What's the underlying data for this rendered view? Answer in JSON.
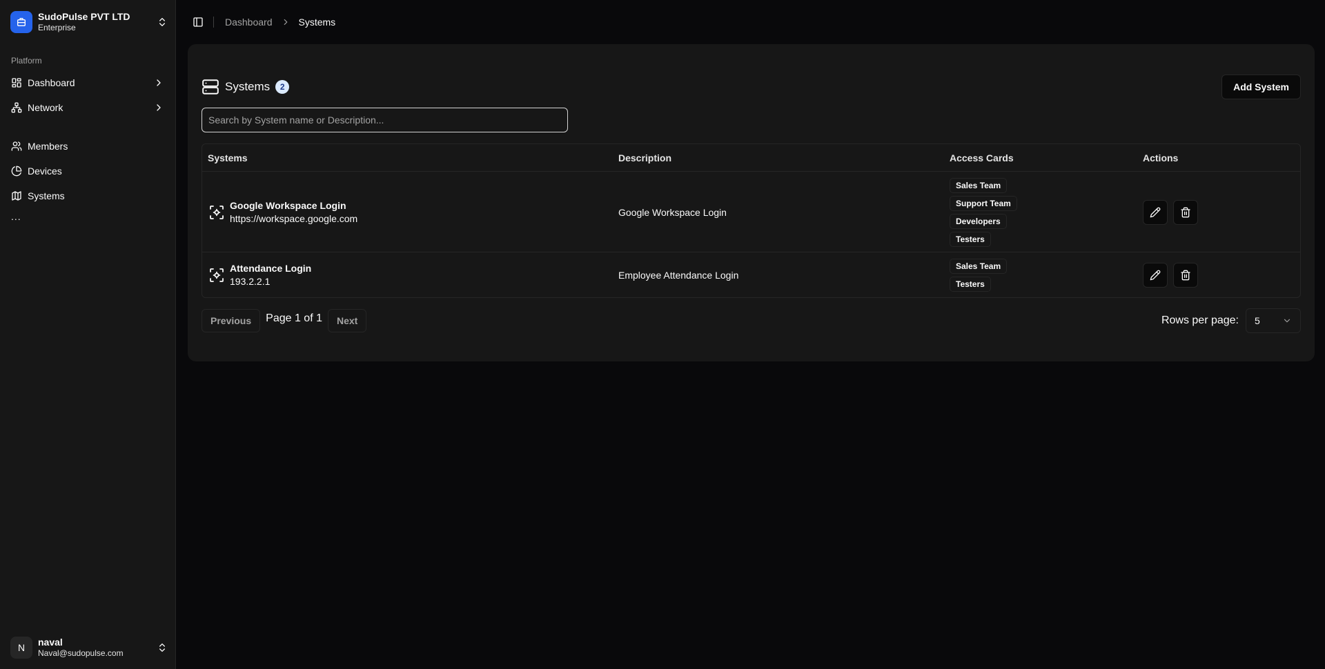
{
  "org": {
    "name": "SudoPulse PVT LTD",
    "plan": "Enterprise",
    "logo_icon": "briefcase-icon"
  },
  "sidebar": {
    "group_label": "Platform",
    "items": [
      {
        "label": "Dashboard",
        "icon": "layout-grid-icon",
        "has_chevron": true
      },
      {
        "label": "Network",
        "icon": "network-icon",
        "has_chevron": true
      },
      {
        "label": "Members",
        "icon": "users-icon"
      },
      {
        "label": "Devices",
        "icon": "pie-chart-icon"
      },
      {
        "label": "Systems",
        "icon": "map-icon"
      }
    ],
    "more_label": "..."
  },
  "user": {
    "initial": "N",
    "name": "naval",
    "email": "Naval@sudopulse.com"
  },
  "breadcrumb": {
    "parent": "Dashboard",
    "current": "Systems"
  },
  "page": {
    "title": "Systems",
    "count": "2",
    "add_button": "Add System",
    "search_placeholder": "Search by System name or Description..."
  },
  "table": {
    "headers": {
      "systems": "Systems",
      "description": "Description",
      "access_cards": "Access Cards",
      "actions": "Actions"
    },
    "rows": [
      {
        "name": "Google Workspace Login",
        "url": "https://workspace.google.com",
        "description": "Google Workspace Login",
        "cards": [
          "Sales Team",
          "Support Team",
          "Developers",
          "Testers"
        ]
      },
      {
        "name": "Attendance Login",
        "url": "193.2.2.1",
        "description": "Employee Attendance Login",
        "cards": [
          "Sales Team",
          "Testers"
        ]
      }
    ]
  },
  "pagination": {
    "previous": "Previous",
    "page_text": "Page 1 of 1",
    "next": "Next",
    "rows_per_page_label": "Rows per page:",
    "rows_per_page_value": "5"
  },
  "colors": {
    "accent": "#2563eb",
    "background": "#09090b",
    "card": "#171717",
    "border": "#262626"
  }
}
